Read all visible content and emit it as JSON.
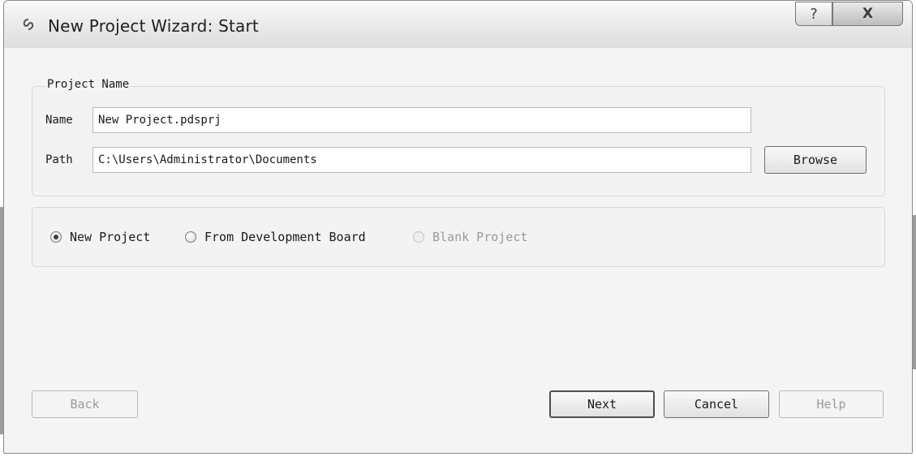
{
  "window": {
    "title": "New Project Wizard: Start",
    "help_glyph": "?",
    "close_glyph": "X"
  },
  "project_name_group": {
    "legend": "Project Name",
    "name_label": "Name",
    "name_value": "New Project.pdsprj",
    "path_label": "Path",
    "path_value": "C:\\Users\\Administrator\\Documents",
    "browse_label": "Browse"
  },
  "project_type": {
    "options": [
      {
        "label": "New Project",
        "checked": true,
        "enabled": true
      },
      {
        "label": "From Development Board",
        "checked": false,
        "enabled": true
      },
      {
        "label": "Blank Project",
        "checked": false,
        "enabled": false
      }
    ]
  },
  "footer": {
    "back_label": "Back",
    "next_label": "Next",
    "cancel_label": "Cancel",
    "help_label": "Help"
  },
  "icons": {
    "app": "proteus-app-icon",
    "help": "help-icon",
    "close": "close-icon"
  }
}
